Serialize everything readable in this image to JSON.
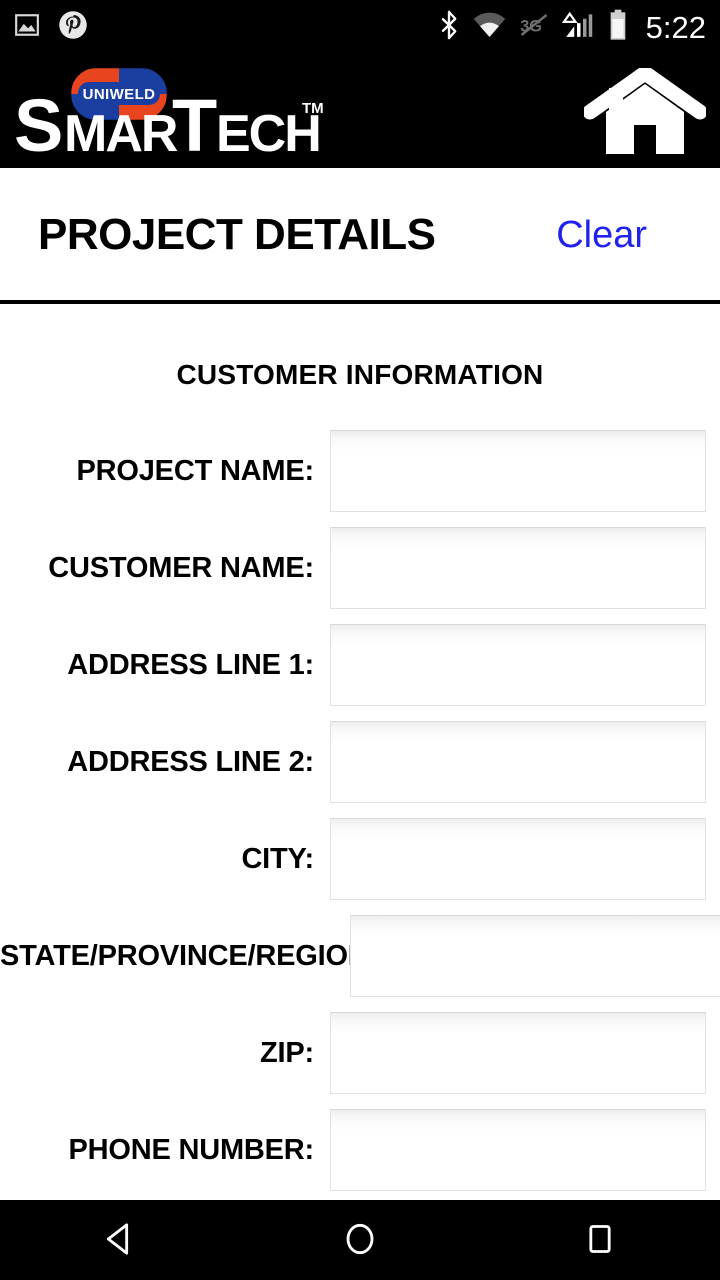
{
  "status_bar": {
    "left_icons": [
      {
        "name": "screenshot-icon",
        "label": "Screenshot"
      },
      {
        "name": "pinterest-icon",
        "label": "Pinterest"
      }
    ],
    "right_icons": [
      {
        "name": "bluetooth-icon",
        "label": "Bluetooth"
      },
      {
        "name": "wifi-icon",
        "label": "Wi-Fi"
      },
      {
        "name": "mobile-data-off-icon",
        "label": "3G off"
      },
      {
        "name": "cellular-signal-icon",
        "label": "Signal"
      },
      {
        "name": "battery-icon",
        "label": "Battery"
      }
    ],
    "clock": "5:22"
  },
  "app_header": {
    "brand_name": "SmarTech",
    "brand_badge": "UNIWELD",
    "trademark": "TM",
    "home_icon": "home-icon",
    "colors": {
      "bar_background": "#000000",
      "badge_red": "#e8451f",
      "badge_blue": "#1b3fa0",
      "brand_text": "#ffffff"
    }
  },
  "page": {
    "title": "PROJECT DETAILS",
    "clear_label": "Clear",
    "clear_color": "#2222ee"
  },
  "form": {
    "section_heading": "CUSTOMER INFORMATION",
    "fields": [
      {
        "label": "PROJECT NAME:",
        "value": "",
        "placeholder": "",
        "name": "project-name"
      },
      {
        "label": "CUSTOMER NAME:",
        "value": "",
        "placeholder": "",
        "name": "customer-name"
      },
      {
        "label": "ADDRESS LINE 1:",
        "value": "",
        "placeholder": "",
        "name": "address-line-1"
      },
      {
        "label": "ADDRESS LINE 2:",
        "value": "",
        "placeholder": "",
        "name": "address-line-2"
      },
      {
        "label": "CITY:",
        "value": "",
        "placeholder": "",
        "name": "city"
      },
      {
        "label": "STATE/PROVINCE/REGION:",
        "value": "",
        "placeholder": "",
        "name": "state-province-region"
      },
      {
        "label": "ZIP:",
        "value": "",
        "placeholder": "",
        "name": "zip"
      },
      {
        "label": "PHONE NUMBER:",
        "value": "",
        "placeholder": "",
        "name": "phone-number"
      }
    ]
  },
  "nav_bar": {
    "back_icon": "back-triangle-icon",
    "home_icon": "home-circle-icon",
    "recents_icon": "recents-square-icon"
  }
}
